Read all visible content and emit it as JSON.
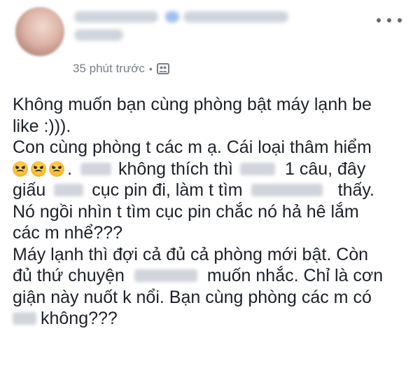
{
  "header": {
    "timestamp": "35 phút trước",
    "separator": "•",
    "privacy_icon": "friends-privacy-icon",
    "more_icon": "more-horizontal-icon"
  },
  "post": {
    "line1": "Không muốn bạn cùng phòng bật máy lạnh be",
    "line2": "like :))).",
    "line3": "Con cùng phòng t các m ạ. Cái loại thâm hiểm",
    "line4_a": ".",
    "line4_b": "không thích thì",
    "line4_c": "1 câu, đây",
    "line5_a": "giấu",
    "line5_b": "cục pin đi, làm t tìm",
    "line5_c": "thấy.",
    "line6": "Nó ngồi nhìn t tìm cục pin chắc nó hả hê lắm",
    "line7": "các m nhể???",
    "line8": "Máy lạnh thì đợi cả đủ cả phòng mới bật. Còn",
    "line9_a": "đủ thứ chuyện",
    "line9_b": "muốn nhắc. Chỉ là cơn",
    "line10": "giận này nuốt k nổi. Bạn cùng phòng các m có",
    "line11": "không???"
  },
  "colors": {
    "text": "#1d2129",
    "meta": "#7a7f88"
  }
}
